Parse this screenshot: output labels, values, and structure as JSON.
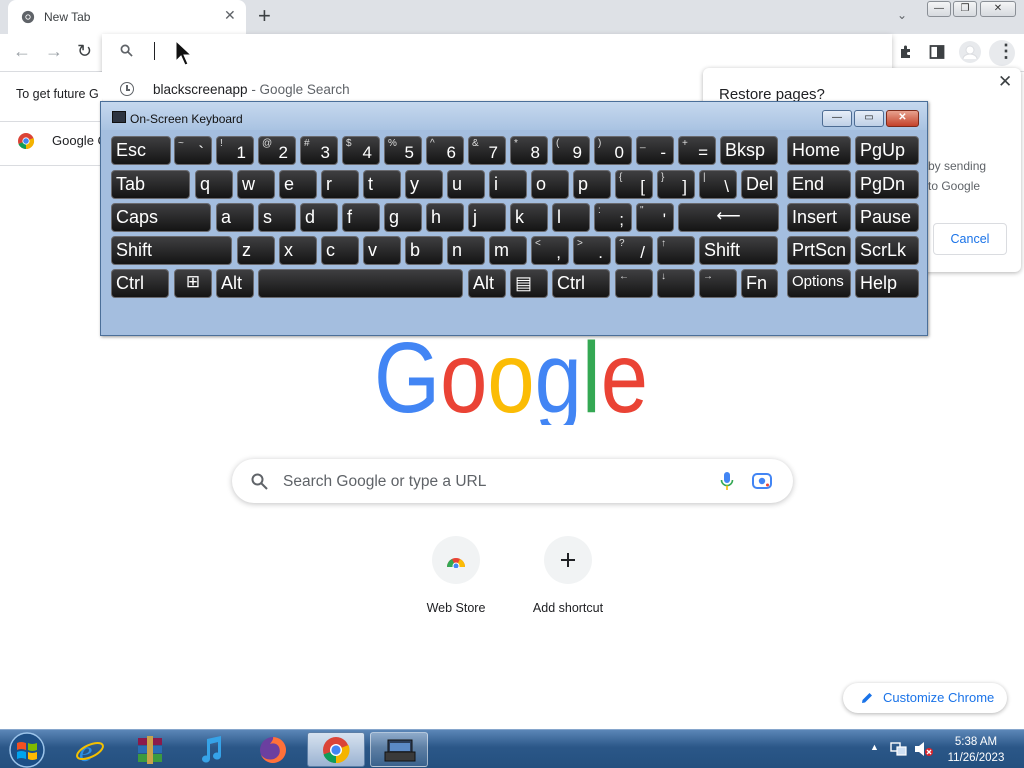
{
  "browser": {
    "tab_title": "New Tab",
    "tab_close": "✕",
    "new_tab": "+",
    "tab_menu": "⌄",
    "win_minimize": "—",
    "win_restore": "❐",
    "win_close": "✕"
  },
  "toolbar": {
    "back": "←",
    "forward": "→",
    "reload": "↻",
    "extensions": "puzzle-icon",
    "side_panel": "side-panel-icon",
    "profile": "profile-icon",
    "menu": "⋮"
  },
  "omnibox": {
    "value": "",
    "suggestion_query": "blackscreenapp",
    "suggestion_suffix": " - Google Search"
  },
  "infobar": {
    "text": "To get future G"
  },
  "bookmark": {
    "label": "Google C"
  },
  "restore_dialog": {
    "title": "Restore pages?",
    "close": "✕",
    "body_line1": "by sending",
    "body_line2": "to Google",
    "cancel_label": "Cancel"
  },
  "osk": {
    "title": "On-Screen Keyboard",
    "rows": [
      [
        {
          "id": "esc",
          "main": "Esc"
        },
        {
          "id": "tilde",
          "sm": "~",
          "big": "`"
        },
        {
          "id": "1",
          "sm": "!",
          "big": "1"
        },
        {
          "id": "2",
          "sm": "@",
          "big": "2"
        },
        {
          "id": "3",
          "sm": "#",
          "big": "3"
        },
        {
          "id": "4",
          "sm": "$",
          "big": "4"
        },
        {
          "id": "5",
          "sm": "%",
          "big": "5"
        },
        {
          "id": "6",
          "sm": "^",
          "big": "6"
        },
        {
          "id": "7",
          "sm": "&",
          "big": "7"
        },
        {
          "id": "8",
          "sm": "*",
          "big": "8"
        },
        {
          "id": "9",
          "sm": "(",
          "big": "9"
        },
        {
          "id": "0",
          "sm": ")",
          "big": "0"
        },
        {
          "id": "minus",
          "sm": "_",
          "big": "-"
        },
        {
          "id": "equals",
          "sm": "+",
          "big": "="
        },
        {
          "id": "bksp",
          "main": "Bksp"
        },
        {
          "id": "home",
          "main": "Home"
        },
        {
          "id": "pgup",
          "main": "PgUp"
        }
      ],
      [
        {
          "id": "tab",
          "main": "Tab"
        },
        {
          "id": "q",
          "main": "q"
        },
        {
          "id": "w",
          "main": "w"
        },
        {
          "id": "e",
          "main": "e"
        },
        {
          "id": "r",
          "main": "r"
        },
        {
          "id": "t",
          "main": "t"
        },
        {
          "id": "y",
          "main": "y"
        },
        {
          "id": "u",
          "main": "u"
        },
        {
          "id": "i",
          "main": "i"
        },
        {
          "id": "o",
          "main": "o"
        },
        {
          "id": "p",
          "main": "p"
        },
        {
          "id": "lbracket",
          "sm": "{",
          "big": "["
        },
        {
          "id": "rbracket",
          "sm": "}",
          "big": "]"
        },
        {
          "id": "backslash",
          "sm": "|",
          "big": "\\"
        },
        {
          "id": "del",
          "main": "Del"
        },
        {
          "id": "end",
          "main": "End"
        },
        {
          "id": "pgdn",
          "main": "PgDn"
        }
      ],
      [
        {
          "id": "caps",
          "main": "Caps"
        },
        {
          "id": "a",
          "main": "a"
        },
        {
          "id": "s",
          "main": "s"
        },
        {
          "id": "d",
          "main": "d"
        },
        {
          "id": "f",
          "main": "f"
        },
        {
          "id": "g",
          "main": "g"
        },
        {
          "id": "h",
          "main": "h"
        },
        {
          "id": "j",
          "main": "j"
        },
        {
          "id": "k",
          "main": "k"
        },
        {
          "id": "l",
          "main": "l"
        },
        {
          "id": "semicolon",
          "sm": ":",
          "big": ";"
        },
        {
          "id": "quote",
          "sm": "\"",
          "big": "'"
        },
        {
          "id": "enter",
          "ctr": "⟵"
        },
        {
          "id": "insert",
          "main": "Insert"
        },
        {
          "id": "pause",
          "main": "Pause"
        }
      ],
      [
        {
          "id": "lshift",
          "main": "Shift"
        },
        {
          "id": "z",
          "main": "z"
        },
        {
          "id": "x",
          "main": "x"
        },
        {
          "id": "c",
          "main": "c"
        },
        {
          "id": "v",
          "main": "v"
        },
        {
          "id": "b",
          "main": "b"
        },
        {
          "id": "n",
          "main": "n"
        },
        {
          "id": "m",
          "main": "m"
        },
        {
          "id": "comma",
          "sm": "<",
          "big": ","
        },
        {
          "id": "period",
          "sm": ">",
          "big": "."
        },
        {
          "id": "slash",
          "sm": "?",
          "big": "/"
        },
        {
          "id": "up",
          "sm": "↑",
          "big": ""
        },
        {
          "id": "rshift",
          "main": "Shift"
        },
        {
          "id": "prtscn",
          "main": "PrtScn"
        },
        {
          "id": "scrlk",
          "main": "ScrLk"
        }
      ],
      [
        {
          "id": "lctrl",
          "main": "Ctrl"
        },
        {
          "id": "win",
          "ctr": "⊞"
        },
        {
          "id": "lalt",
          "main": "Alt"
        },
        {
          "id": "space",
          "main": ""
        },
        {
          "id": "ralt",
          "main": "Alt"
        },
        {
          "id": "menu",
          "main": "▤"
        },
        {
          "id": "rctrl",
          "main": "Ctrl"
        },
        {
          "id": "left",
          "sm": "←",
          "big": ""
        },
        {
          "id": "down",
          "sm": "↓",
          "big": ""
        },
        {
          "id": "right",
          "sm": "→",
          "big": ""
        },
        {
          "id": "fn",
          "main": "Fn"
        },
        {
          "id": "options",
          "main": "Options"
        },
        {
          "id": "help",
          "main": "Help"
        }
      ]
    ]
  },
  "ntp": {
    "search_placeholder": "Search Google or type a URL",
    "shortcuts": [
      {
        "label": "Web Store",
        "icon": "web-store-icon"
      },
      {
        "label": "Add shortcut",
        "icon": "plus-icon"
      }
    ],
    "customize_label": "Customize Chrome",
    "logo_colors": [
      "#4285F4",
      "#EA4335",
      "#FBBC05",
      "#4285F4",
      "#34A853",
      "#EA4335"
    ]
  },
  "taskbar": {
    "apps": [
      "start-orb",
      "internet-explorer",
      "winrar",
      "itunes",
      "firefox",
      "chrome",
      "on-screen-keyboard"
    ],
    "time": "5:38 AM",
    "date": "11/26/2023",
    "tray_arrow": "▲"
  }
}
